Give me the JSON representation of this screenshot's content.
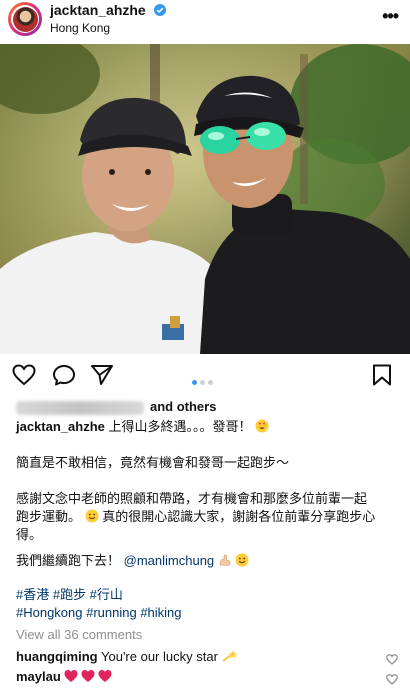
{
  "post": {
    "username": "jacktan_ahzhe",
    "location": "Hong Kong",
    "likes_suffix": "and others"
  },
  "caption": {
    "username": "jacktan_ahzhe",
    "line1": "上得山多終遇。。。發哥！",
    "line2": "簡直是不敢相信，竟然有機會和發哥一起跑步～",
    "line3": "感謝文念中老師的照顧和帶路，才有機會和那麼多位前輩一起",
    "line4": "跑步運動。",
    "line4b": "真的很開心認識大家，謝謝各位前輩分享跑步心",
    "line5": "得。",
    "line6": "我們繼續跑下去！",
    "mention": "@manlimchung",
    "hashtags_1": "#香港 #跑步 #行山",
    "hashtags_2": "#Hongkong #running #hiking"
  },
  "view_comments": "View all 36 comments",
  "comments": [
    {
      "user": "huangqiming",
      "text": "You're our lucky star"
    },
    {
      "user": "maylau",
      "text": ""
    }
  ]
}
